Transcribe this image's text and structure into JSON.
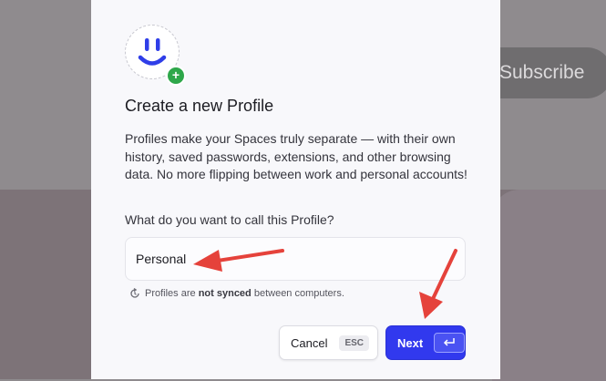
{
  "background": {
    "subscribe_label": "Subscribe"
  },
  "dialog": {
    "title": "Create a new Profile",
    "description": "Profiles make your Spaces truly separate — with their own history, saved passwords, extensions, and other browsing data. No more flipping between work and personal accounts!",
    "question": "What do you want to call this Profile?",
    "name_value": "Personal",
    "sync_note_prefix": "Profiles are ",
    "sync_note_bold": "not synced",
    "sync_note_suffix": " between computers.",
    "cancel_label": "Cancel",
    "cancel_shortcut": "ESC",
    "next_label": "Next",
    "avatar_icon": "smiley-icon",
    "add_icon": "plus-icon",
    "sync_icon": "sync-icon",
    "enter_icon": "enter-key-icon"
  },
  "annotations": {
    "arrow_color": "#e5423b"
  },
  "colors": {
    "primary": "#3139ee",
    "avatar_badge": "#2ea74a"
  }
}
